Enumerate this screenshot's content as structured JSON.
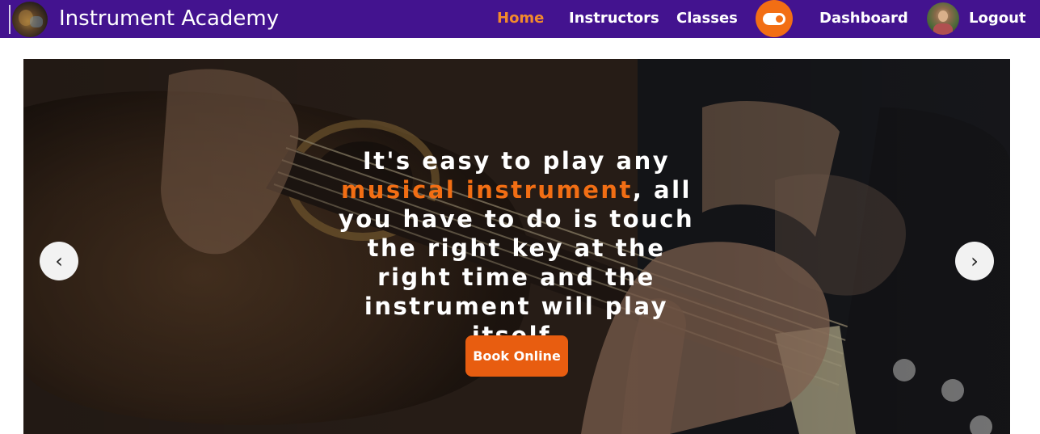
{
  "brand": {
    "title": "Instrument Academy",
    "logo_icon": "guitar-logo-icon"
  },
  "nav": {
    "links": [
      {
        "label": "Home",
        "active": true
      },
      {
        "label": "Instructors",
        "active": false
      },
      {
        "label": "Classes",
        "active": false
      },
      {
        "label": "Dashboard",
        "active": false
      },
      {
        "label": "Logout",
        "active": false
      }
    ],
    "theme_toggle_icon": "toggle-switch-icon",
    "avatar_icon": "user-avatar"
  },
  "hero": {
    "title_part1": "It's easy to play any",
    "title_highlight": "musical instrument",
    "title_part2": ", all you have to do is touch the right key at the right time and the instrument will play itself.",
    "button_label": "Book Online",
    "prev_symbol": "‹",
    "next_symbol": "›"
  },
  "colors": {
    "navbar": "#43138f",
    "accent": "#f26e14",
    "active_link": "#f28a2c",
    "button": "#e85d10"
  }
}
